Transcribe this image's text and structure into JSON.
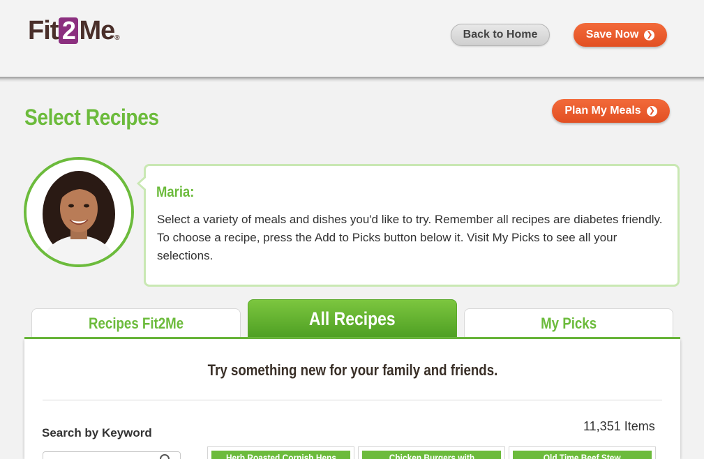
{
  "header": {
    "logo": {
      "prefix": "Fit",
      "mark": "2",
      "suffix": "Me",
      "registered": "®"
    },
    "back_label": "Back to Home",
    "save_label": "Save Now"
  },
  "page": {
    "title": "Select Recipes",
    "plan_label": "Plan My Meals"
  },
  "coach": {
    "name": "Maria:",
    "message": "Select a variety of meals and dishes you'd like to try. Remember all recipes are diabetes friendly. To choose a recipe, press the Add to Picks button below it. Visit My Picks to see all your selections."
  },
  "tabs": [
    {
      "label": "Recipes Fit2Me",
      "active": false
    },
    {
      "label": "All Recipes",
      "active": true
    },
    {
      "label": "My Picks",
      "active": false
    }
  ],
  "content": {
    "tagline": "Try something new for your family and friends.",
    "search_label": "Search by Keyword",
    "search_value": "",
    "items_count": "11,351 Items",
    "recipes": [
      {
        "title": "Herb Roasted Cornish Hens"
      },
      {
        "title": "Chicken Burgers with"
      },
      {
        "title": "Old Time Beef Stew"
      }
    ]
  },
  "colors": {
    "brand_green": "#6cbb3c",
    "accent_orange": "#e8592a",
    "logo_purple": "#8b2f7f"
  }
}
